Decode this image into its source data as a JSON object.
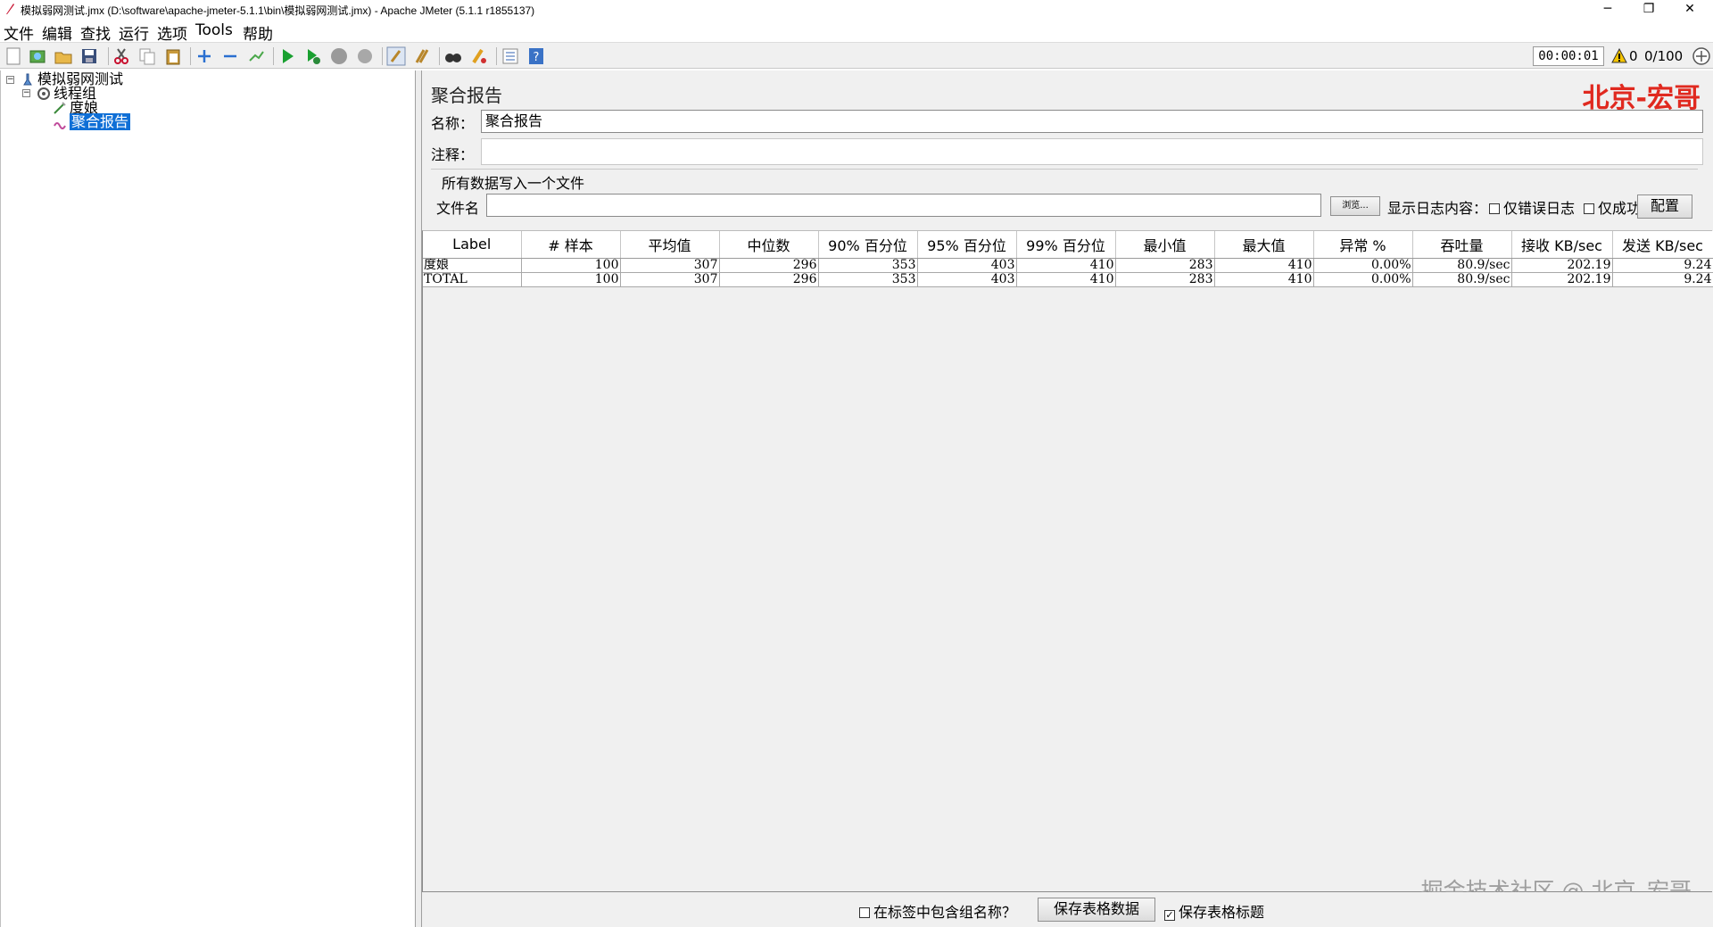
{
  "window": {
    "title": "模拟弱网测试.jmx (D:\\software\\apache-jmeter-5.1.1\\bin\\模拟弱网测试.jmx) - Apache JMeter (5.1.1 r1855137)",
    "minimize": "─",
    "restore": "❐",
    "close": "✕"
  },
  "menu": {
    "file": "文件",
    "edit": "编辑",
    "search": "查找",
    "run": "运行",
    "options": "选项",
    "tools": "Tools",
    "help": "帮助"
  },
  "toolbar": {
    "icons": [
      "new-icon",
      "templates-icon",
      "open-icon",
      "save-icon",
      "cut-icon",
      "copy-icon",
      "paste-icon",
      "expand-icon",
      "collapse-icon",
      "toggle-icon",
      "start-icon",
      "start-no-pause-icon",
      "stop-icon",
      "shutdown-icon",
      "clear-icon",
      "clear-all-icon",
      "search-icon",
      "reset-search-icon",
      "function-helper-icon",
      "help-icon"
    ],
    "timer": "00:00:01",
    "warning_count": "0",
    "threads": "0/100"
  },
  "tree": {
    "root": "模拟弱网测试",
    "thread_group": "线程组",
    "sampler": "度娘",
    "listener": "聚合报告"
  },
  "panel": {
    "title": "聚合报告",
    "watermark": "北京-宏哥",
    "name_label": "名称：",
    "name_value": "聚合报告",
    "comment_label": "注释：",
    "comment_value": "",
    "file_group_title": "所有数据写入一个文件",
    "filename_label": "文件名",
    "filename_value": "",
    "browse_button": "浏览...",
    "log_display_label": "显示日志内容：",
    "errors_only_label": "仅错误日志",
    "success_only_label": "仅成功日志",
    "configure_button": "配置"
  },
  "table": {
    "columns": [
      "Label",
      "# 样本",
      "平均值",
      "中位数",
      "90% 百分位",
      "95% 百分位",
      "99% 百分位",
      "最小值",
      "最大值",
      "异常 %",
      "吞吐量",
      "接收 KB/sec",
      "发送 KB/sec"
    ],
    "rows": [
      [
        "度娘",
        "100",
        "307",
        "296",
        "353",
        "403",
        "410",
        "283",
        "410",
        "0.00%",
        "80.9/sec",
        "202.19",
        "9.24"
      ],
      [
        "TOTAL",
        "100",
        "307",
        "296",
        "353",
        "403",
        "410",
        "283",
        "410",
        "0.00%",
        "80.9/sec",
        "202.19",
        "9.24"
      ]
    ]
  },
  "bottom": {
    "include_group_label": "在标签中包含组名称？",
    "include_group_checked": "",
    "save_table_button": "保存表格数据",
    "save_header_label": "保存表格标题",
    "save_header_checked": "✓",
    "watermark": "掘金技术社区 @ 北京_宏哥"
  },
  "colors": {
    "selection": "#0f6fd6",
    "watermark_red": "#e0291f",
    "panel_bg": "#f0f0f0"
  }
}
